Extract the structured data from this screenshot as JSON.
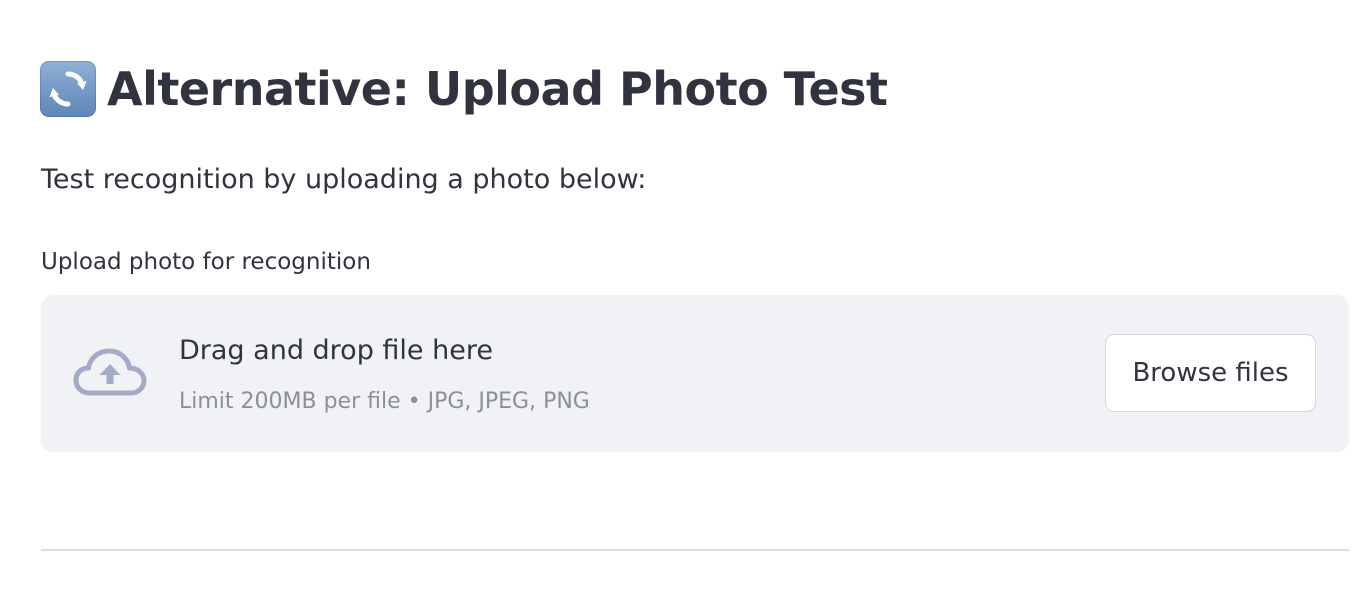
{
  "header": {
    "emoji_icon": "counterclockwise-arrows-icon",
    "title": "Alternative: Upload Photo Test"
  },
  "intro_text": "Test recognition by uploading a photo below:",
  "uploader": {
    "label": "Upload photo for recognition",
    "icon": "cloud-upload-icon",
    "drop_text": "Drag and drop file here",
    "limit_text": "Limit 200MB per file • JPG, JPEG, PNG",
    "browse_label": "Browse files"
  },
  "colors": {
    "text": "#31333f",
    "muted_text": "#8c8f99",
    "dropzone_bg": "#f0f2f6",
    "icon": "#a3abc6",
    "emoji_bg": "#6d92c2"
  }
}
